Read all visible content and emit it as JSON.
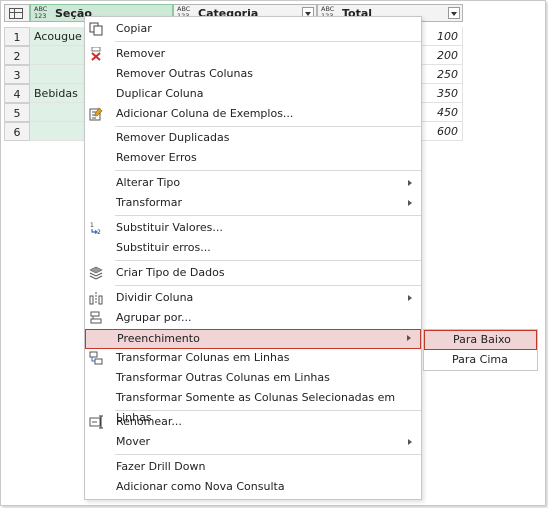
{
  "grid": {
    "columns": [
      {
        "type": "ABC\n123",
        "name": "Seção"
      },
      {
        "type": "ABC\n123",
        "name": "Categoria"
      },
      {
        "type": "ABC\n123",
        "name": "Total"
      }
    ],
    "rows": [
      {
        "n": "1",
        "secao": "Acougue",
        "total": "100"
      },
      {
        "n": "2",
        "secao": "",
        "total": "200"
      },
      {
        "n": "3",
        "secao": "",
        "total": "250"
      },
      {
        "n": "4",
        "secao": "Bebidas",
        "total": "350"
      },
      {
        "n": "5",
        "secao": "",
        "total": "450"
      },
      {
        "n": "6",
        "secao": "",
        "total": "600"
      }
    ]
  },
  "menu": {
    "copy": "Copiar",
    "remove": "Remover",
    "remove_other": "Remover Outras Colunas",
    "duplicate": "Duplicar Coluna",
    "add_example": "Adicionar Coluna de Exemplos...",
    "remove_duplicates": "Remover Duplicadas",
    "remove_errors": "Remover Erros",
    "change_type": "Alterar Tipo",
    "transform": "Transformar",
    "replace_values": "Substituir Valores...",
    "replace_errors": "Substituir erros...",
    "create_data_type": "Criar Tipo de Dados",
    "split_column": "Dividir Coluna",
    "group_by": "Agrupar por...",
    "fill": "Preenchimento",
    "unpivot": "Transformar Colunas em Linhas",
    "unpivot_other": "Transformar Outras Colunas em Linhas",
    "unpivot_selected": "Transformar Somente as Colunas Selecionadas em Linhas",
    "rename": "Renomear...",
    "move": "Mover",
    "drill_down": "Fazer Drill Down",
    "add_as_query": "Adicionar como Nova Consulta"
  },
  "submenu": {
    "down": "Para Baixo",
    "up": "Para Cima"
  }
}
